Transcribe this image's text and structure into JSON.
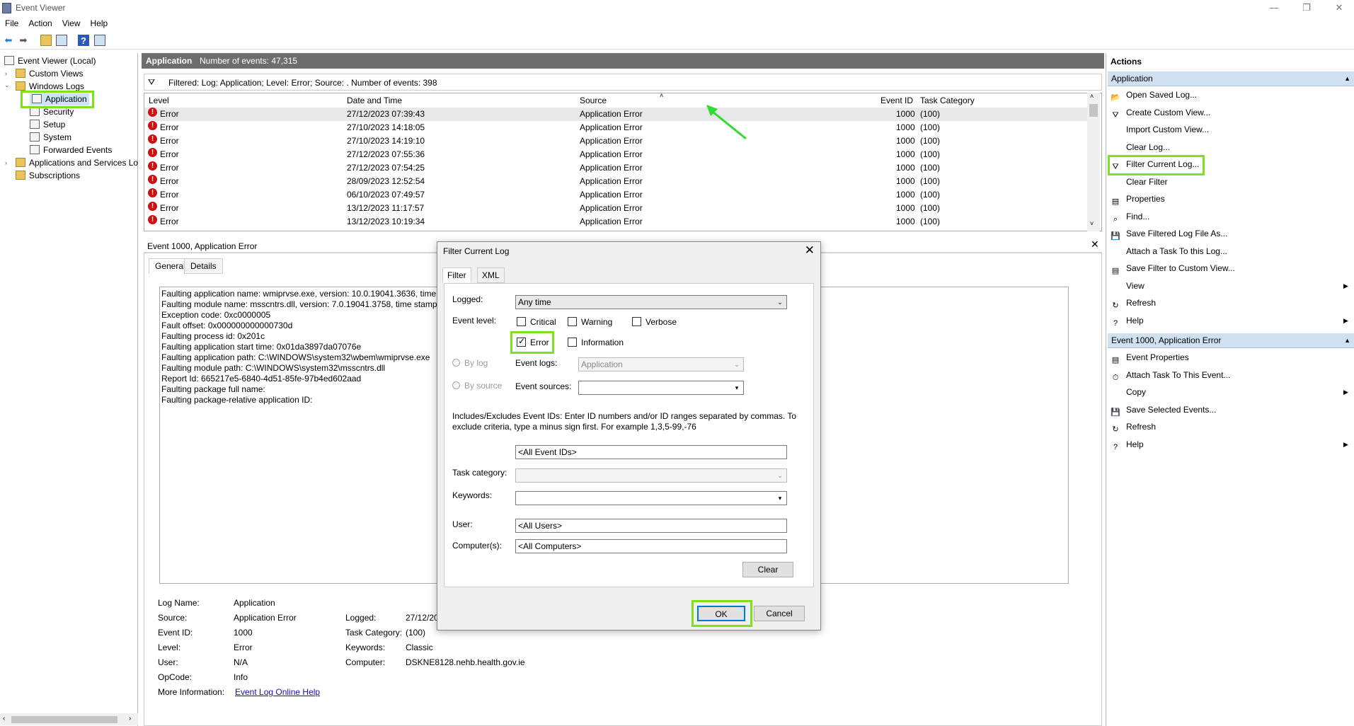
{
  "window": {
    "title": "Event Viewer"
  },
  "menu": [
    "File",
    "Action",
    "View",
    "Help"
  ],
  "tree": {
    "root": "Event Viewer (Local)",
    "custom_views": "Custom Views",
    "windows_logs": "Windows Logs",
    "logs": [
      "Application",
      "Security",
      "Setup",
      "System",
      "Forwarded Events"
    ],
    "apps_services": "Applications and Services Lo",
    "subscriptions": "Subscriptions"
  },
  "header": {
    "name": "Application",
    "count": "Number of events: 47,315"
  },
  "filter_text": "Filtered: Log: Application; Level: Error; Source: . Number of events: 398",
  "grid": {
    "columns": [
      "Level",
      "Date and Time",
      "Source",
      "Event ID",
      "Task Category"
    ],
    "rows": [
      [
        "Error",
        "27/12/2023 07:39:43",
        "Application Error",
        "1000",
        "(100)"
      ],
      [
        "Error",
        "27/10/2023 14:18:05",
        "Application Error",
        "1000",
        "(100)"
      ],
      [
        "Error",
        "27/10/2023 14:19:10",
        "Application Error",
        "1000",
        "(100)"
      ],
      [
        "Error",
        "27/12/2023 07:55:36",
        "Application Error",
        "1000",
        "(100)"
      ],
      [
        "Error",
        "27/12/2023 07:54:25",
        "Application Error",
        "1000",
        "(100)"
      ],
      [
        "Error",
        "28/09/2023 12:52:54",
        "Application Error",
        "1000",
        "(100)"
      ],
      [
        "Error",
        "06/10/2023 07:49:57",
        "Application Error",
        "1000",
        "(100)"
      ],
      [
        "Error",
        "13/12/2023 11:17:57",
        "Application Error",
        "1000",
        "(100)"
      ],
      [
        "Error",
        "13/12/2023 10:19:34",
        "Application Error",
        "1000",
        "(100)"
      ]
    ]
  },
  "detail": {
    "title": "Event 1000, Application Error",
    "tabs": [
      "General",
      "Details"
    ],
    "description": [
      "Faulting application name: wmiprvse.exe, version: 10.0.19041.3636, time st",
      "Faulting module name: msscntrs.dll, version: 7.0.19041.3758, time stamp: 0",
      "Exception code: 0xc0000005",
      "Fault offset: 0x000000000000730d",
      "Faulting process id: 0x201c",
      "Faulting application start time: 0x01da3897da07076e",
      "Faulting application path: C:\\WINDOWS\\system32\\wbem\\wmiprvse.exe",
      "Faulting module path: C:\\WINDOWS\\system32\\msscntrs.dll",
      "Report Id: 665217e5-6840-4d51-85fe-97b4ed602aad",
      "Faulting package full name:",
      "Faulting package-relative application ID:"
    ],
    "props": {
      "log_name_label": "Log Name:",
      "log_name": "Application",
      "source_label": "Source:",
      "source": "Application Error",
      "logged_label": "Logged:",
      "logged": "27/12/20",
      "event_id_label": "Event ID:",
      "event_id": "1000",
      "task_label": "Task Category:",
      "task": "(100)",
      "level_label": "Level:",
      "level": "Error",
      "keywords_label": "Keywords:",
      "keywords": "Classic",
      "user_label": "User:",
      "user": "N/A",
      "computer_label": "Computer:",
      "computer": "DSKNE8128.nehb.health.gov.ie",
      "opcode_label": "OpCode:",
      "opcode": "Info",
      "more_label": "More Information:",
      "more_link": "Event Log Online Help"
    }
  },
  "actions": {
    "title": "Actions",
    "section1": "Application",
    "items1": [
      "Open Saved Log...",
      "Create Custom View...",
      "Import Custom View...",
      "Clear Log...",
      "Filter Current Log...",
      "Clear Filter",
      "Properties",
      "Find...",
      "Save Filtered Log File As...",
      "Attach a Task To this Log...",
      "Save Filter to Custom View...",
      "View",
      "Refresh",
      "Help"
    ],
    "section2": "Event 1000, Application Error",
    "items2": [
      "Event Properties",
      "Attach Task To This Event...",
      "Copy",
      "Save Selected Events...",
      "Refresh",
      "Help"
    ]
  },
  "dialog": {
    "title": "Filter Current Log",
    "tabs": [
      "Filter",
      "XML"
    ],
    "logged_label": "Logged:",
    "logged_value": "Any time",
    "event_level_label": "Event level:",
    "levels": {
      "critical": "Critical",
      "warning": "Warning",
      "verbose": "Verbose",
      "error": "Error",
      "information": "Information"
    },
    "by_log": "By log",
    "by_source": "By source",
    "event_logs_label": "Event logs:",
    "event_logs_value": "Application",
    "event_sources_label": "Event sources:",
    "help_text": "Includes/Excludes Event IDs: Enter ID numbers and/or ID ranges separated by commas. To exclude criteria, type a minus sign first. For example 1,3,5-99,-76",
    "event_ids": "<All Event IDs>",
    "task_category_label": "Task category:",
    "keywords_label": "Keywords:",
    "user_label": "User:",
    "user_value": "<All Users>",
    "computer_label": "Computer(s):",
    "computer_value": "<All Computers>",
    "clear": "Clear",
    "ok": "OK",
    "cancel": "Cancel"
  },
  "colors": {
    "highlight": "#7fe01e",
    "error": "#cc1111",
    "section": "#cfe0f1"
  }
}
